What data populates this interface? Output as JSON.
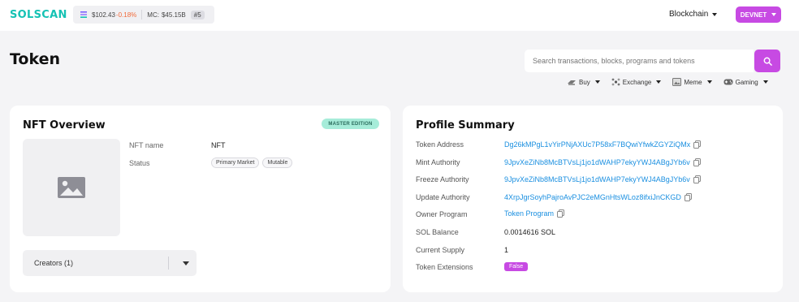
{
  "header": {
    "logo": "SOLSCAN",
    "sol_price": "$102.43",
    "sol_change": "-0.18%",
    "market_cap_label": "MC:",
    "market_cap": "$45.15B",
    "rank": "#5",
    "blockchain_label": "Blockchain",
    "network_label": "DEVNET"
  },
  "page": {
    "title": "Token"
  },
  "search": {
    "placeholder": "Search transactions, blocks, programs and tokens"
  },
  "quick_links": [
    {
      "label": "Buy",
      "icon": "buy-icon"
    },
    {
      "label": "Exchange",
      "icon": "exchange-icon"
    },
    {
      "label": "Meme",
      "icon": "meme-icon"
    },
    {
      "label": "Gaming",
      "icon": "gaming-icon"
    }
  ],
  "nft_overview": {
    "title": "NFT Overview",
    "badge": "MASTER EDITION",
    "name_label": "NFT name",
    "name_value": "NFT",
    "status_label": "Status",
    "status_tags": [
      "Primary Market",
      "Mutable"
    ],
    "creators_label": "Creators (1)"
  },
  "profile_summary": {
    "title": "Profile Summary",
    "rows": [
      {
        "label": "Token Address",
        "value": "Dg26kMPgL1vYirPNjAXUc7P58xF7BQwiYfwkZGYZiQMx"
      },
      {
        "label": "Mint Authority",
        "value": "9JpvXeZiNb8McBTVsLj1jo1dWAHP7ekyYWJ4ABgJYb6v"
      },
      {
        "label": "Freeze Authority",
        "value": "9JpvXeZiNb8McBTVsLj1jo1dWAHP7ekyYWJ4ABgJYb6v"
      },
      {
        "label": "Update Authority",
        "value": "4XrpJgrSoyhPajroAvPJC2eMGnHtsWLoz8ifxiJnCKGD"
      },
      {
        "label": "Owner Program",
        "value": "Token Program"
      },
      {
        "label": "SOL Balance",
        "value": "0.0014616 SOL"
      },
      {
        "label": "Current Supply",
        "value": "1"
      },
      {
        "label": "Token Extensions",
        "value": "False"
      }
    ]
  },
  "colors": {
    "brand": "#16c2b4",
    "accent": "#c74ae3",
    "link": "#1a8fe0",
    "badge_green": "#a6ecd9",
    "negative": "#f26a3a"
  }
}
